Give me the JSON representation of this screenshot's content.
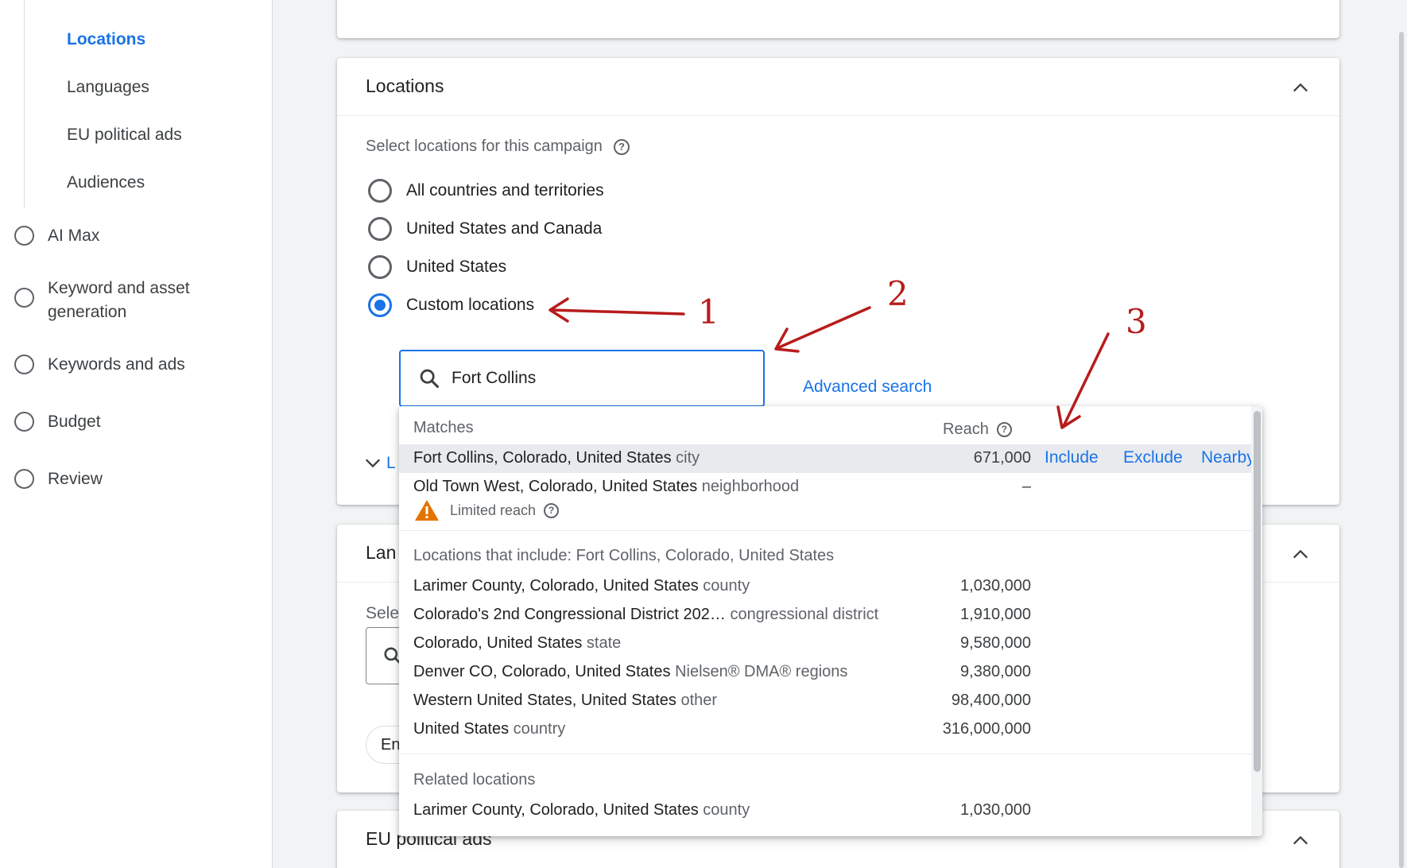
{
  "sidebar": {
    "sub_items": [
      {
        "label": "Locations",
        "active": true
      },
      {
        "label": "Languages",
        "active": false
      },
      {
        "label": "EU political ads",
        "active": false
      },
      {
        "label": "Audiences",
        "active": false
      }
    ],
    "steps": [
      {
        "label": "AI Max"
      },
      {
        "label": "Keyword and asset generation"
      },
      {
        "label": "Keywords and ads"
      },
      {
        "label": "Budget"
      },
      {
        "label": "Review"
      }
    ]
  },
  "locations_card": {
    "title": "Locations",
    "select_label": "Select locations for this campaign",
    "radio_options": [
      {
        "label": "All countries and territories",
        "checked": false
      },
      {
        "label": "United States and Canada",
        "checked": false
      },
      {
        "label": "United States",
        "checked": false
      },
      {
        "label": "Custom locations",
        "checked": true
      }
    ],
    "search": {
      "value": "Fort Collins"
    },
    "advanced_search": "Advanced search",
    "partial_link": "L"
  },
  "languages_card": {
    "title_partial": "Lan",
    "select_partial": "Sele",
    "chip_partial": "En"
  },
  "eu_card": {
    "title": "EU political ads"
  },
  "dropdown": {
    "matches_header": "Matches",
    "reach_header": "Reach",
    "matches": [
      {
        "name": "Fort Collins, Colorado, United States",
        "type": "city",
        "reach": "671,000",
        "actions": [
          "Include",
          "Exclude",
          "Nearby"
        ]
      },
      {
        "name": "Old Town West, Colorado, United States",
        "type": "neighborhood",
        "reach": "–",
        "warning": "Limited reach"
      }
    ],
    "includes_header": "Locations that include: Fort Collins, Colorado, United States",
    "includes": [
      {
        "name": "Larimer County, Colorado, United States",
        "type": "county",
        "reach": "1,030,000"
      },
      {
        "name": "Colorado's 2nd Congressional District 202…",
        "type": "congressional district",
        "reach": "1,910,000"
      },
      {
        "name": "Colorado, United States",
        "type": "state",
        "reach": "9,580,000"
      },
      {
        "name": "Denver CO, Colorado, United States",
        "type": "Nielsen® DMA® regions",
        "reach": "9,380,000"
      },
      {
        "name": "Western United States, United States",
        "type": "other",
        "reach": "98,400,000"
      },
      {
        "name": "United States",
        "type": "country",
        "reach": "316,000,000"
      }
    ],
    "related_header": "Related locations",
    "related": [
      {
        "name": "Larimer County, Colorado, United States",
        "type": "county",
        "reach": "1,030,000"
      }
    ]
  },
  "annotations": [
    {
      "label": "1"
    },
    {
      "label": "2"
    },
    {
      "label": "3"
    }
  ],
  "colors": {
    "accent": "#1a73e8",
    "annotation": "#b71c1c",
    "warning": "#e37400"
  }
}
